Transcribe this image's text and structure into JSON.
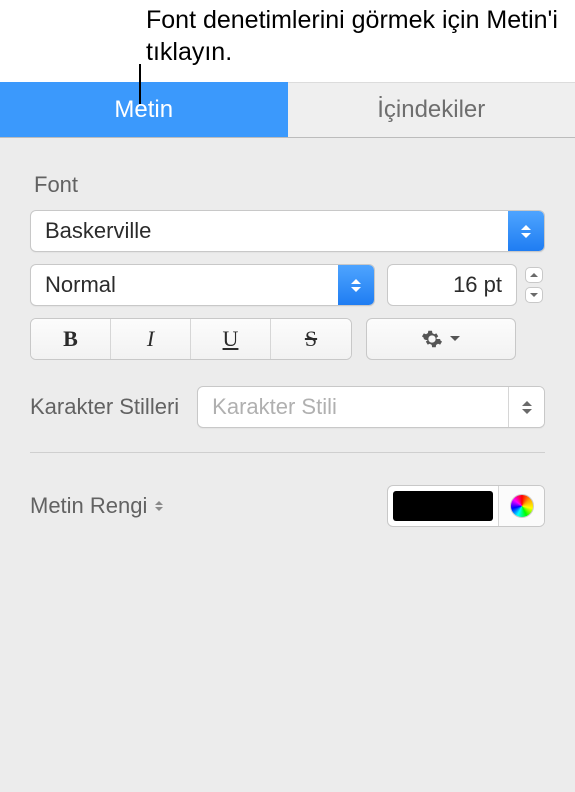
{
  "callout": "Font denetimlerini görmek için Metin'i tıklayın.",
  "tabs": {
    "text": "Metin",
    "contents": "İçindekiler"
  },
  "font": {
    "section_label": "Font",
    "family": "Baskerville",
    "style": "Normal",
    "size": "16 pt",
    "glyphs": {
      "bold": "B",
      "italic": "I",
      "underline": "U",
      "strike": "S"
    }
  },
  "character_styles": {
    "label": "Karakter Stilleri",
    "placeholder": "Karakter Stili"
  },
  "text_color": {
    "label": "Metin Rengi",
    "value": "#000000"
  }
}
